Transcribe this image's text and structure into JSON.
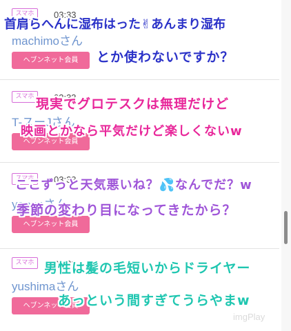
{
  "posts": [
    {
      "tag": "スマホ",
      "time": "03:33",
      "name": "machimoさん",
      "badge": "ヘブンネット会員"
    },
    {
      "tag": "スマホ",
      "time": "03:33",
      "name": "T-スーJさん",
      "badge": "ヘブンネット会員"
    },
    {
      "tag": "スマホ",
      "time": "03:33",
      "name": "yoppaさん",
      "badge": "ヘブンネット会員"
    },
    {
      "tag": "スマホ",
      "time": "03:33",
      "name": "yushimaさん",
      "badge": "ヘブンネット会員"
    }
  ],
  "overlay": {
    "line1": "首肩らへんに湿布はった✌あんまり湿布",
    "line2": "とか使わないですか？",
    "line3": "現実でグロテスクは無理だけど",
    "line4": "映画とかなら平気だけど楽しくないw",
    "line5": "ここずっと天気悪いね？💦なんでだ？w",
    "line6": "季節の変わり目になってきたから？",
    "line7": "男性は髪の毛短いからドライヤー",
    "line8": "あっという間すぎてうらやまw"
  },
  "watermark": "imgPlay",
  "colors": {
    "overlay_blue": "#2b32c8",
    "overlay_pink": "#e8279a",
    "overlay_purple": "#9f55d8",
    "overlay_green": "#1ec6b0",
    "badge": "#f06a9a",
    "name": "#6f95cf"
  }
}
